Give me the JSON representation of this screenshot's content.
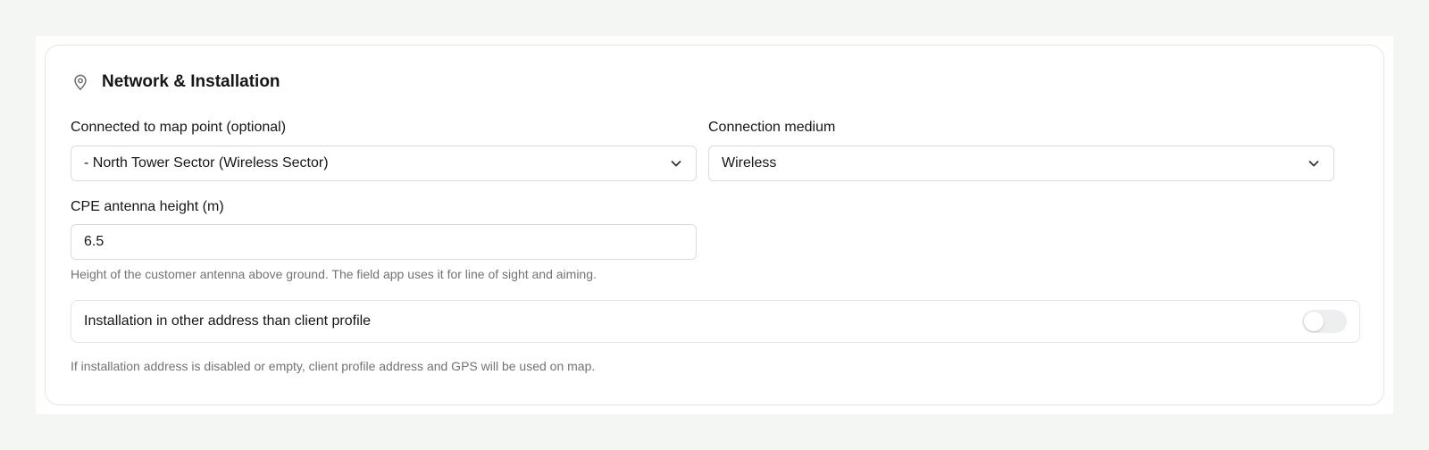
{
  "section": {
    "title": "Network & Installation",
    "icon": "map-pin-icon"
  },
  "map_point": {
    "label": "Connected to map point (optional)",
    "value": "- North Tower Sector (Wireless Sector)"
  },
  "connection_medium": {
    "label": "Connection medium",
    "value": "Wireless"
  },
  "antenna_height": {
    "label": "CPE antenna height (m)",
    "value": "6.5",
    "hint": "Height of the customer antenna above ground. The field app uses it for line of sight and aiming."
  },
  "install_address": {
    "label": "Installation in other address than client profile",
    "enabled": false,
    "hint": "If installation address is disabled or empty, client profile address and GPS will be used on map."
  }
}
